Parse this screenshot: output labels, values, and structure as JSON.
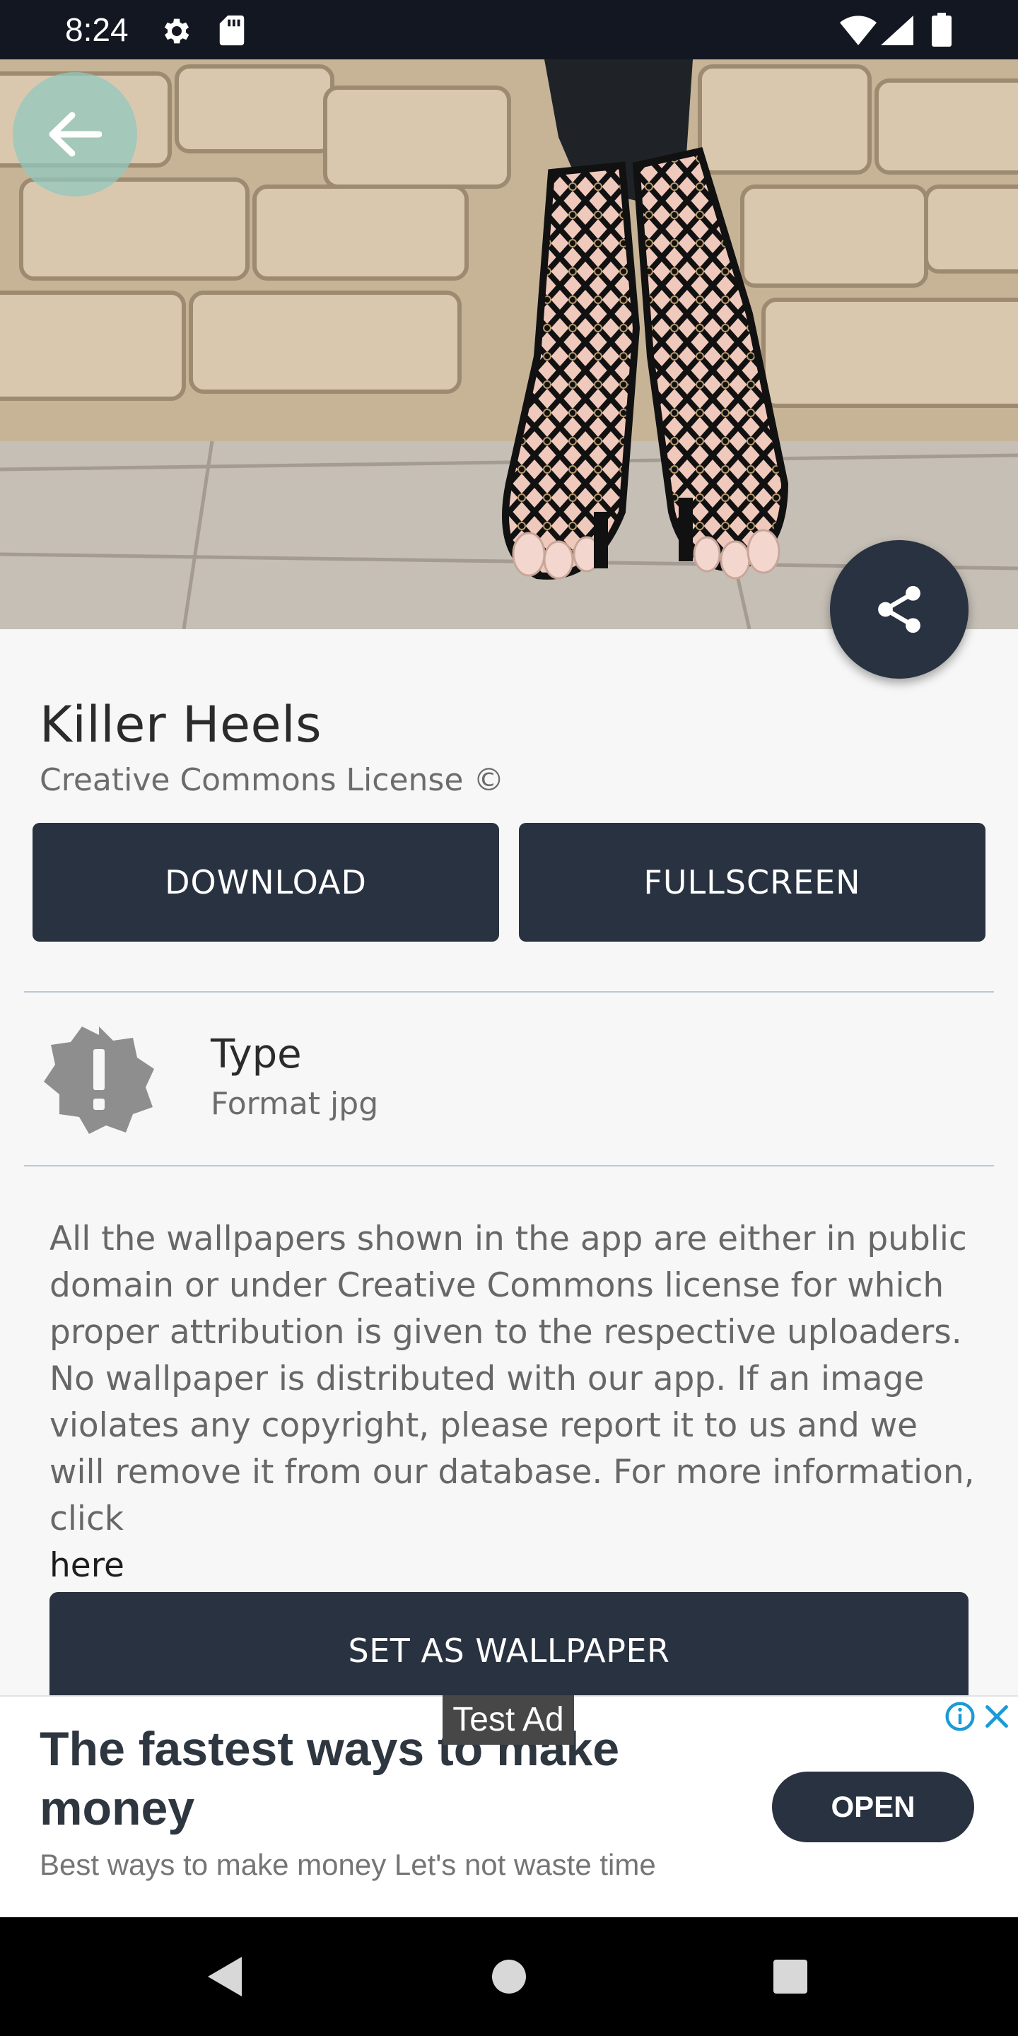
{
  "status_bar": {
    "time": "8:24",
    "icons": [
      "gear-icon",
      "sd-card-icon",
      "wifi-icon",
      "signal-icon",
      "battery-icon"
    ]
  },
  "wallpaper": {
    "title": "Killer Heels",
    "license": "Creative Commons License ©",
    "download_label": "DOWNLOAD",
    "fullscreen_label": "FULLSCREEN",
    "type_label": "Type",
    "type_value": "Format jpg",
    "disclaimer": "All the wallpapers shown in the app are either in public domain or under Creative Commons license for which proper attribution is given to the respective uploaders. No wallpaper is distributed with our app. If an image violates any copyright, please report it to us and we will remove it from our database. For more information, click",
    "disclaimer_link": "here",
    "set_wallpaper_label": "SET AS WALLPAPER"
  },
  "ad": {
    "test_label": "Test Ad",
    "headline": "The fastest ways to make money",
    "body": "Best ways to make money Let's not waste time",
    "cta": "OPEN"
  },
  "colors": {
    "primary": "#293240",
    "status_bar": "#121722",
    "background": "#f7f7f7",
    "divider": "#bcc7d3",
    "back_button": "#92c8be"
  }
}
